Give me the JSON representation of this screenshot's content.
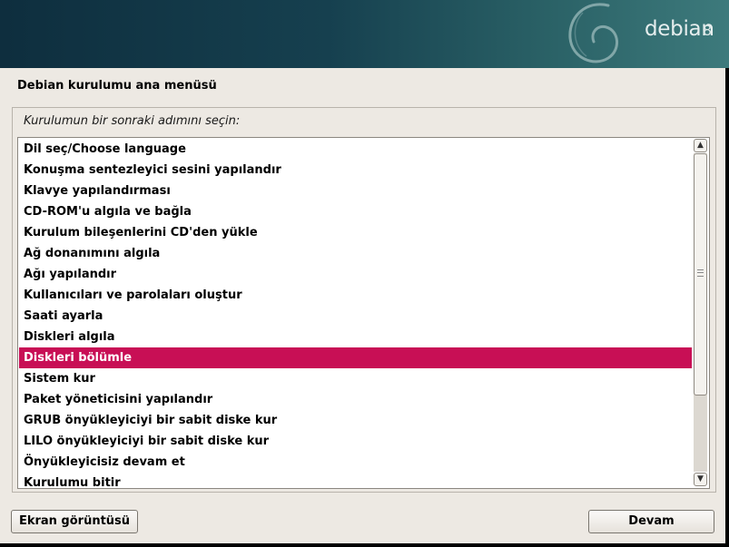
{
  "banner": {
    "logo_text": "debian",
    "logo_version": "8",
    "colors": {
      "dark": "#0e2e3e",
      "light": "#3d7a7c"
    }
  },
  "page_title": "Debian kurulumu ana menüsü",
  "prompt": "Kurulumun bir sonraki adımını seçin:",
  "menu": {
    "selected_index": 10,
    "selected_color": "#c80f55",
    "items": [
      "Dil seç/Choose language",
      "Konuşma sentezleyici sesini yapılandır",
      "Klavye yapılandırması",
      "CD-ROM'u algıla ve bağla",
      "Kurulum bileşenlerini CD'den yükle",
      "Ağ donanımını algıla",
      "Ağı yapılandır",
      "Kullanıcıları ve parolaları oluştur",
      "Saati ayarla",
      "Diskleri algıla",
      "Diskleri bölümle",
      "Sistem kur",
      "Paket yöneticisini yapılandır",
      "GRUB önyükleyiciyi bir sabit diske kur",
      "LILO önyükleyiciyi bir sabit diske kur",
      "Önyükleyicisiz devam et",
      "Kurulumu bitir"
    ]
  },
  "buttons": {
    "screenshot": "Ekran görüntüsü",
    "continue": "Devam"
  },
  "icons": {
    "scroll_up": "▲",
    "scroll_down": "▼"
  }
}
